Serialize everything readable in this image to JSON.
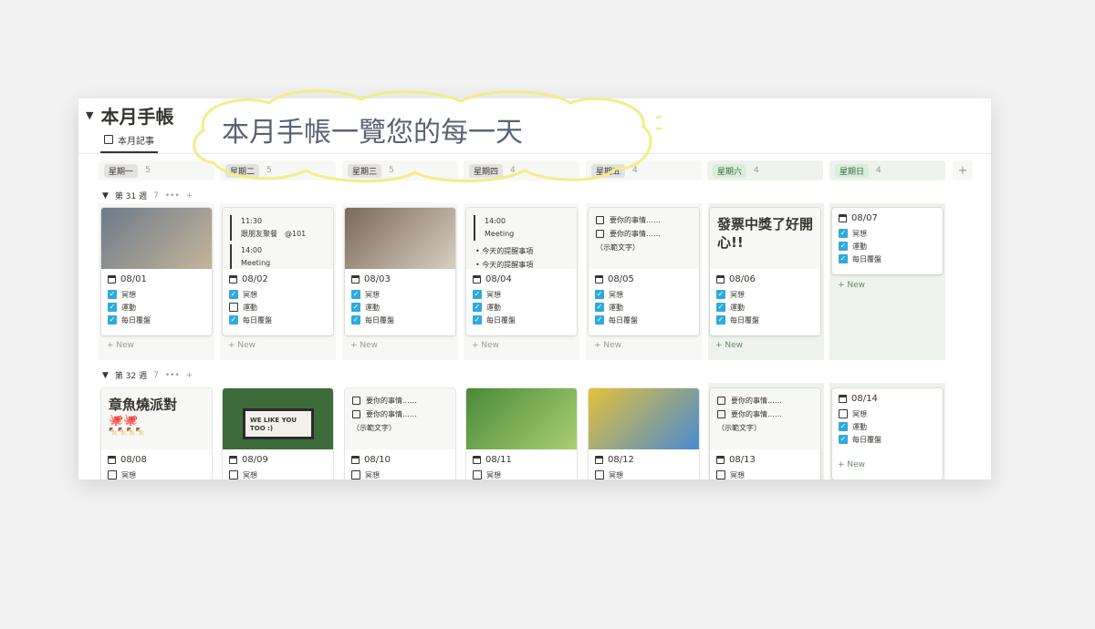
{
  "page": {
    "title": "本月手帳",
    "view_tab": "本月記事"
  },
  "overlay": {
    "handwriting": "本月手帳一覽您的每一天"
  },
  "columns": [
    {
      "label": "星期一",
      "count": "5"
    },
    {
      "label": "星期二",
      "count": "5"
    },
    {
      "label": "星期三",
      "count": "5"
    },
    {
      "label": "星期四",
      "count": "4"
    },
    {
      "label": "星期五",
      "count": "4"
    },
    {
      "label": "星期六",
      "count": "4"
    },
    {
      "label": "星期日",
      "count": "4"
    }
  ],
  "add_column": "+",
  "weeks": [
    {
      "label": "第 31 週",
      "count": "7",
      "dots": "•••",
      "plus": "+"
    },
    {
      "label": "第 32 週",
      "count": "7",
      "dots": "•••",
      "plus": "+"
    }
  ],
  "new_label": "+ New",
  "checklist_labels": [
    "冥想",
    "運動",
    "每日覆盤"
  ],
  "week1": [
    {
      "date": "08/01",
      "checks": [
        true,
        true,
        true
      ],
      "cover": "photo"
    },
    {
      "date": "08/02",
      "checks": [
        true,
        false,
        true
      ],
      "cover": "times",
      "t1": "11:30",
      "t1b": "跟朋友聚餐　@101",
      "t2": "14:00",
      "t2b": "Meeting"
    },
    {
      "date": "08/03",
      "checks": [
        true,
        true,
        true
      ],
      "cover": "photo"
    },
    {
      "date": "08/04",
      "checks": [
        true,
        true,
        true
      ],
      "cover": "bullets",
      "t1": "14:00",
      "t1b": "Meeting",
      "b1": "今天的提醒事項",
      "b2": "今天的提醒事項"
    },
    {
      "date": "08/05",
      "checks": [
        true,
        true,
        true
      ],
      "cover": "todos",
      "d1": "要你的事情……",
      "d2": "要你的事情……",
      "d3": "（示範文字）"
    },
    {
      "date": "08/06",
      "checks": [
        true,
        true,
        true
      ],
      "cover": "text",
      "big": "發票中獎了好開心!!"
    },
    {
      "date": "08/07",
      "checks": [
        true,
        true,
        true
      ],
      "cover": "none"
    }
  ],
  "week2": [
    {
      "date": "08/08",
      "cover": "text",
      "big": "章魚燒派對",
      "emoji": "🐙🐙",
      "small": "🍢🍢🍢🍢"
    },
    {
      "date": "08/09",
      "cover": "sign",
      "sign": "WE LIKE YOU TOO :)"
    },
    {
      "date": "08/10",
      "cover": "todos",
      "d1": "要你的事情……",
      "d2": "要你的事情……",
      "d3": "（示範文字）"
    },
    {
      "date": "08/11",
      "cover": "photo"
    },
    {
      "date": "08/12",
      "cover": "photo"
    },
    {
      "date": "08/13",
      "cover": "todos",
      "d1": "要你的事情……",
      "d2": "要你的事情……",
      "d3": "（示範文字）"
    },
    {
      "date": "08/14",
      "checks": [
        false,
        true,
        true
      ],
      "cover": "none"
    }
  ],
  "colors": {
    "accent": "#2eaadc",
    "green_tag": "#dbeddb",
    "highlight": "#f4ec8a"
  }
}
